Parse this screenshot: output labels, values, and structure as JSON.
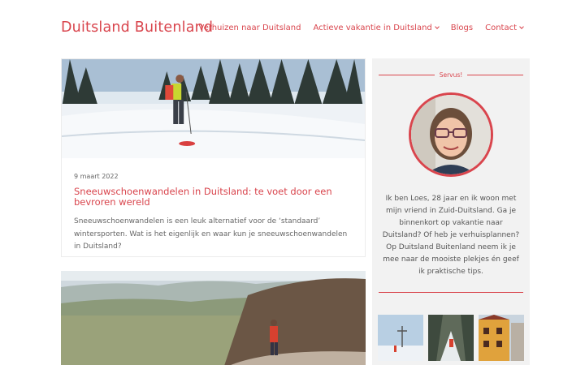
{
  "header": {
    "site_title": "Duitsland Buitenland",
    "nav": [
      {
        "label": "Verhuizen naar Duitsland",
        "has_dropdown": false
      },
      {
        "label": "Actieve vakantie in Duitsland",
        "has_dropdown": true
      },
      {
        "label": "Blogs",
        "has_dropdown": false
      },
      {
        "label": "Contact",
        "has_dropdown": true
      }
    ]
  },
  "posts": [
    {
      "image": "snowshoe-hiker-snowy-forest",
      "date": "9 maart 2022",
      "title": "Sneeuwschoenwandelen in Duitsland: te voet door een bevroren wereld",
      "excerpt": "Sneeuwschoenwandelen is een leuk alternatief voor de ‘standaard’ wintersporten. Wat is het eigenlijk en waar kun je sneeuwschoenwandelen in Duitsland?"
    },
    {
      "image": "hiker-overlooking-valley"
    }
  ],
  "sidebar": {
    "heading": "Servus!",
    "avatar": "portrait-loes",
    "bio": "Ik ben Loes, 28 jaar en ik woon met mijn vriend in Zuid-Duitsland. Ga je binnenkort op vakantie naar Duitsland? Of heb je verhuisplannen? Op Duitsland Buitenland neem ik je mee naar de mooiste plekjes én geef ik praktische tips.",
    "instagram": [
      {
        "image": "snowy-cross-summit"
      },
      {
        "image": "hiker-in-snowy-forest"
      },
      {
        "image": "timber-frame-house"
      }
    ]
  },
  "colors": {
    "accent": "#d9454d",
    "sidebar_bg": "#f2f2f2",
    "text": "#555555"
  }
}
